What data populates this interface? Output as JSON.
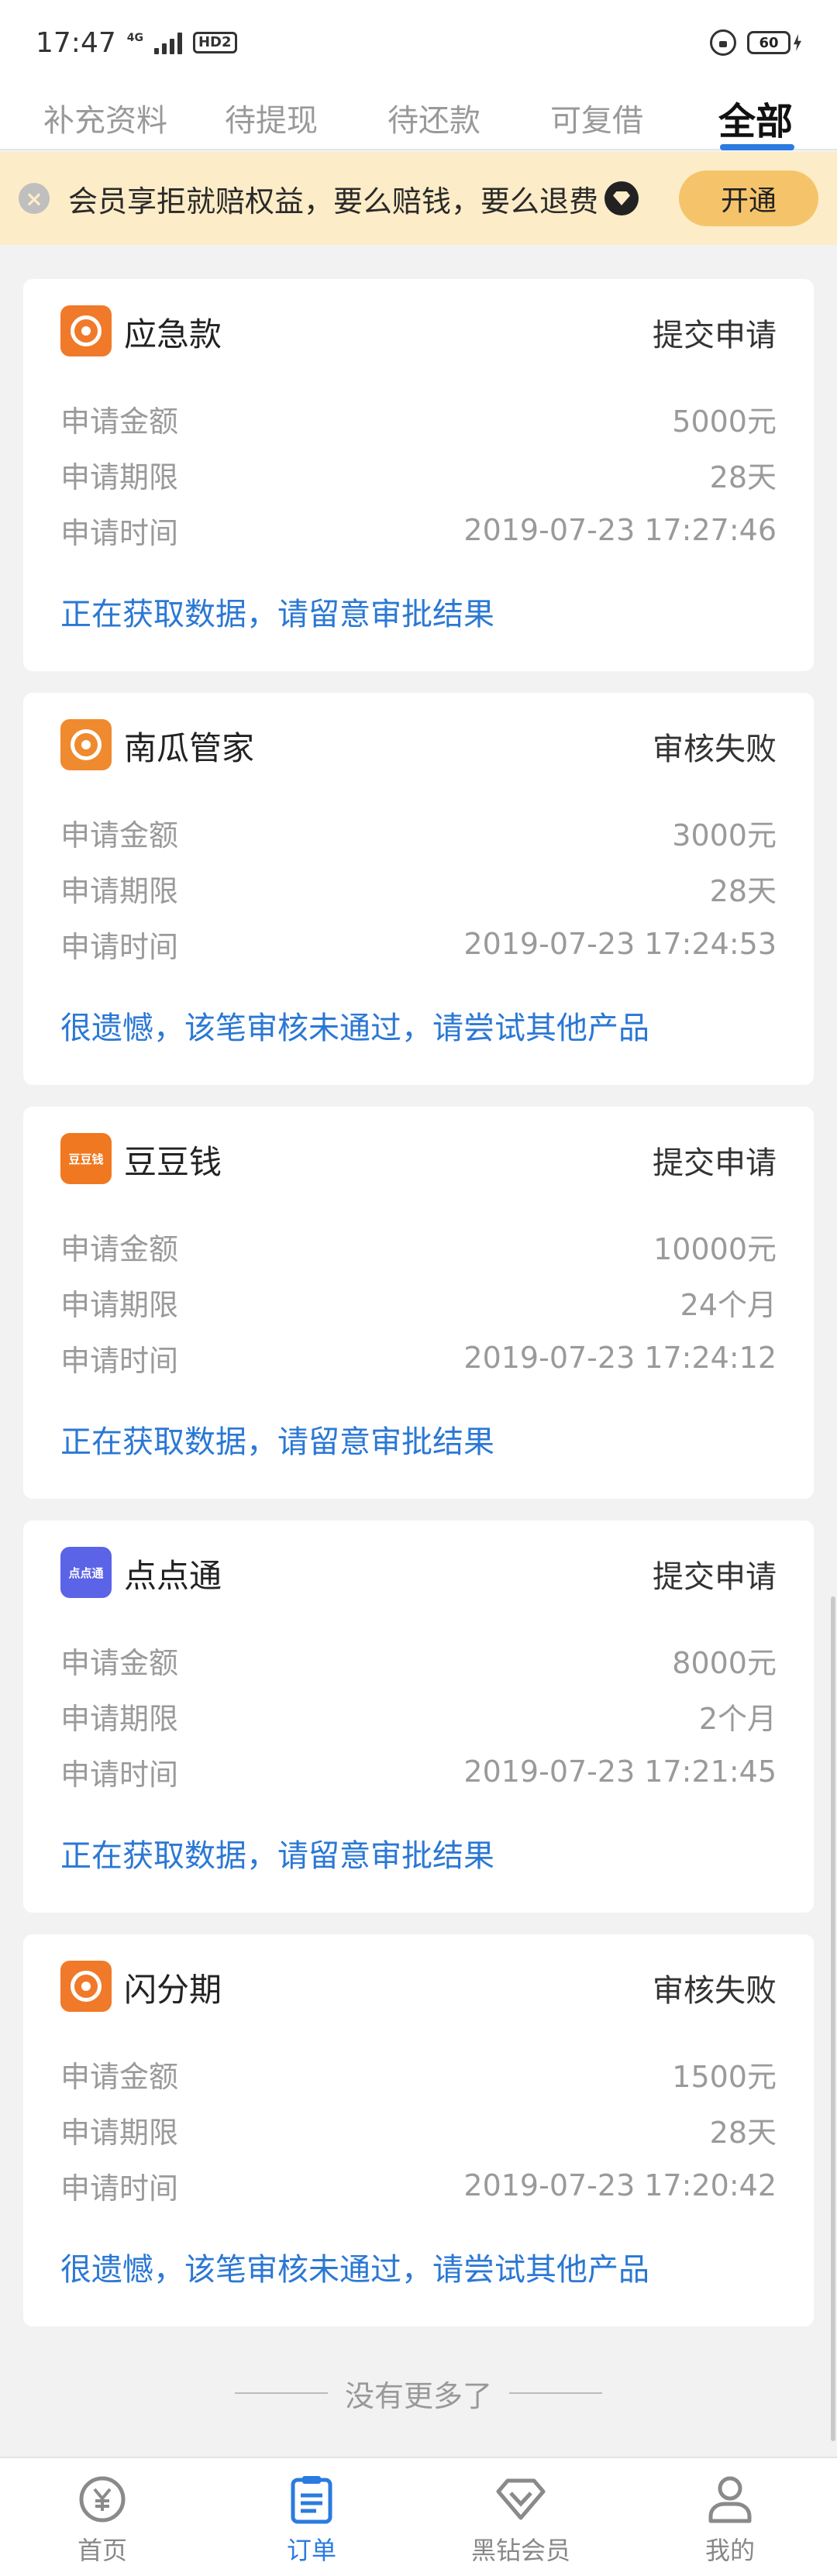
{
  "status_bar": {
    "time": "17:47",
    "network": "4G",
    "hd": "HD2",
    "battery": "60"
  },
  "tabs": [
    {
      "label": "补充资料",
      "active": false
    },
    {
      "label": "待提现",
      "active": false
    },
    {
      "label": "待还款",
      "active": false
    },
    {
      "label": "可复借",
      "active": false
    },
    {
      "label": "全部",
      "active": true
    }
  ],
  "banner": {
    "text": "会员享拒就赔权益，要么赔钱，要么退费",
    "button": "开通"
  },
  "orders": [
    {
      "name": "应急款",
      "status": "提交申请",
      "logo_color": "#f07a2a",
      "rows": [
        {
          "label": "申请金额",
          "value": "5000元"
        },
        {
          "label": "申请期限",
          "value": "28天"
        },
        {
          "label": "申请时间",
          "value": "2019-07-23 17:27:46"
        }
      ],
      "note": "正在获取数据，请留意审批结果"
    },
    {
      "name": "南瓜管家",
      "status": "审核失败",
      "logo_color": "#f08a2e",
      "rows": [
        {
          "label": "申请金额",
          "value": "3000元"
        },
        {
          "label": "申请期限",
          "value": "28天"
        },
        {
          "label": "申请时间",
          "value": "2019-07-23 17:24:53"
        }
      ],
      "note": "很遗憾，该笔审核未通过，请尝试其他产品"
    },
    {
      "name": "豆豆钱",
      "status": "提交申请",
      "logo_color": "#f07820",
      "logo_text": "豆豆钱",
      "rows": [
        {
          "label": "申请金额",
          "value": "10000元"
        },
        {
          "label": "申请期限",
          "value": "24个月"
        },
        {
          "label": "申请时间",
          "value": "2019-07-23 17:24:12"
        }
      ],
      "note": "正在获取数据，请留意审批结果"
    },
    {
      "name": "点点通",
      "status": "提交申请",
      "logo_color": "#5b63e6",
      "logo_text": "点点通",
      "rows": [
        {
          "label": "申请金额",
          "value": "8000元"
        },
        {
          "label": "申请期限",
          "value": "2个月"
        },
        {
          "label": "申请时间",
          "value": "2019-07-23 17:21:45"
        }
      ],
      "note": "正在获取数据，请留意审批结果"
    },
    {
      "name": "闪分期",
      "status": "审核失败",
      "logo_color": "#f07a2a",
      "rows": [
        {
          "label": "申请金额",
          "value": "1500元"
        },
        {
          "label": "申请期限",
          "value": "28天"
        },
        {
          "label": "申请时间",
          "value": "2019-07-23 17:20:42"
        }
      ],
      "note": "很遗憾，该笔审核未通过，请尝试其他产品"
    }
  ],
  "no_more": "没有更多了",
  "bottom_nav": [
    {
      "label": "首页",
      "icon": "yuan-coin-icon",
      "active": false
    },
    {
      "label": "订单",
      "icon": "clipboard-icon",
      "active": true
    },
    {
      "label": "黑钻会员",
      "icon": "diamond-icon",
      "active": false
    },
    {
      "label": "我的",
      "icon": "person-icon",
      "active": false
    }
  ],
  "colors": {
    "accent": "#2b7be0",
    "banner_bg": "#fdecc8",
    "banner_button": "#f5c46a",
    "note_blue": "#2b78d4"
  }
}
